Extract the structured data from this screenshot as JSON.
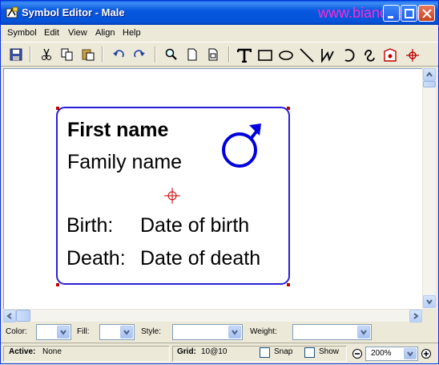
{
  "window": {
    "title": "Symbol Editor - Male",
    "watermark": "www.biancheng"
  },
  "menu": [
    "Symbol",
    "Edit",
    "View",
    "Align",
    "Help"
  ],
  "symbol": {
    "first_name": "First name",
    "family_name": "Family name",
    "birth_label": "Birth:",
    "birth_value": "Date of birth",
    "death_label": "Death:",
    "death_value": "Date of death",
    "gender_glyph": "male-symbol-icon",
    "border_color": "#2a20d8",
    "center_marker_color": "#cc0000"
  },
  "properties": {
    "color_label": "Color:",
    "fill_label": "Fill:",
    "style_label": "Style:",
    "weight_label": "Weight:"
  },
  "status": {
    "active_label": "Active:",
    "active_value": "None",
    "grid_label": "Grid:",
    "grid_value": "10@10",
    "snap_label": "Snap",
    "show_label": "Show",
    "zoom_value": "200%"
  }
}
